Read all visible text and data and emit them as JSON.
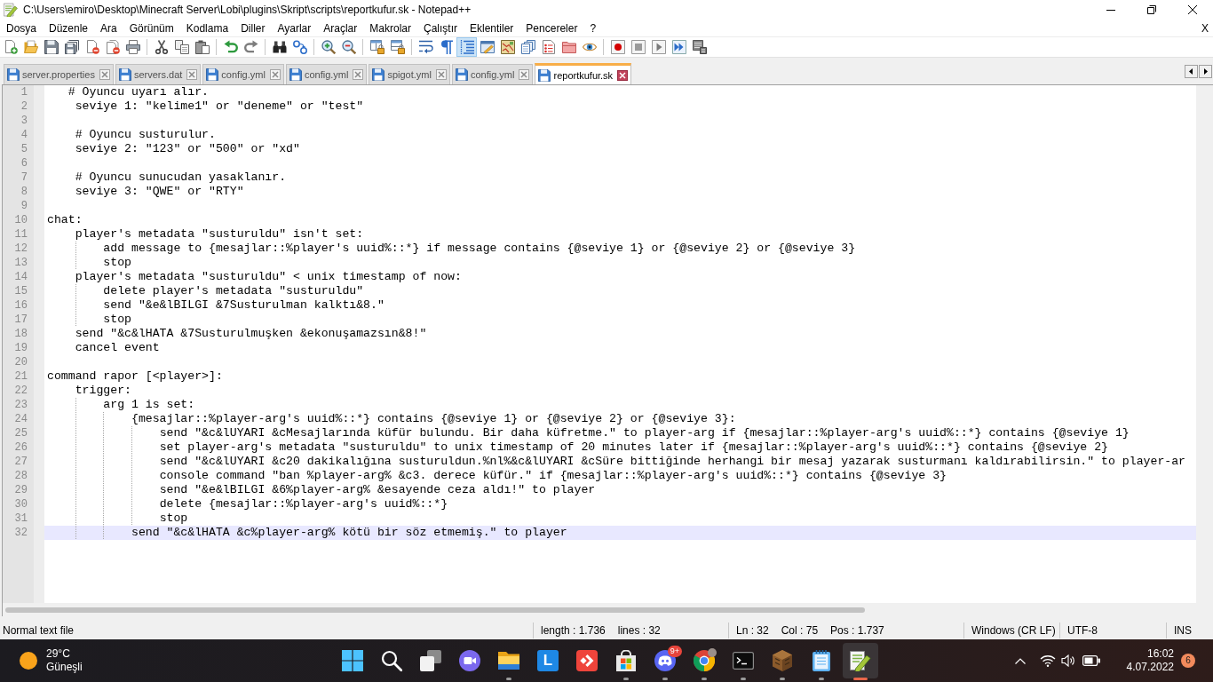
{
  "window": {
    "title": "C:\\Users\\emiro\\Desktop\\Minecraft Server\\Lobi\\plugins\\Skript\\scripts\\reportkufur.sk - Notepad++"
  },
  "menu": {
    "items": [
      "Dosya",
      "Düzenle",
      "Ara",
      "Görünüm",
      "Kodlama",
      "Diller",
      "Ayarlar",
      "Araçlar",
      "Makrolar",
      "Çalıştır",
      "Eklentiler",
      "Pencereler",
      "?"
    ],
    "close_label": "X"
  },
  "toolbar": {
    "groups": [
      [
        {
          "kind": "new",
          "selected": false
        },
        {
          "kind": "open",
          "selected": false
        },
        {
          "kind": "save",
          "selected": false
        },
        {
          "kind": "saveall",
          "selected": false
        },
        {
          "kind": "close",
          "selected": false
        },
        {
          "kind": "closeall",
          "selected": false
        },
        {
          "kind": "print",
          "selected": false
        }
      ],
      [
        {
          "kind": "cut",
          "selected": false
        },
        {
          "kind": "copy",
          "selected": false
        },
        {
          "kind": "paste",
          "selected": false
        }
      ],
      [
        {
          "kind": "undo",
          "selected": false
        },
        {
          "kind": "redo",
          "selected": false
        }
      ],
      [
        {
          "kind": "find",
          "selected": false
        },
        {
          "kind": "replace",
          "selected": false
        }
      ],
      [
        {
          "kind": "zoomin",
          "selected": false
        },
        {
          "kind": "zoomout",
          "selected": false
        }
      ],
      [
        {
          "kind": "syncv",
          "selected": false
        },
        {
          "kind": "synch",
          "selected": false
        }
      ],
      [
        {
          "kind": "wrap",
          "selected": false
        },
        {
          "kind": "pilcrow",
          "selected": false
        },
        {
          "kind": "indent",
          "selected": true
        },
        {
          "kind": "udl",
          "selected": false
        },
        {
          "kind": "docmap",
          "selected": false
        },
        {
          "kind": "doclist",
          "selected": false
        },
        {
          "kind": "funclist",
          "selected": false
        },
        {
          "kind": "workspace",
          "selected": false
        },
        {
          "kind": "monitor",
          "selected": false
        }
      ],
      [
        {
          "kind": "record",
          "selected": false
        },
        {
          "kind": "stop",
          "selected": false
        },
        {
          "kind": "play",
          "selected": false
        },
        {
          "kind": "playmulti",
          "selected": false
        },
        {
          "kind": "savemacro",
          "selected": false
        }
      ]
    ]
  },
  "tabs": [
    {
      "label": "server.properties",
      "selected": false
    },
    {
      "label": "servers.dat",
      "selected": false
    },
    {
      "label": "config.yml",
      "selected": false
    },
    {
      "label": "config.yml",
      "selected": false
    },
    {
      "label": "spigot.yml",
      "selected": false
    },
    {
      "label": "config.yml",
      "selected": false
    },
    {
      "label": "reportkufur.sk",
      "selected": true
    }
  ],
  "editor": {
    "lines": [
      {
        "number": "1",
        "text": "   # Oyuncu uyarı alır.",
        "current": false
      },
      {
        "number": "2",
        "text": "    seviye 1: \"kelime1\" or \"deneme\" or \"test\"",
        "current": false
      },
      {
        "number": "3",
        "current": false
      },
      {
        "number": "4",
        "text": "    # Oyuncu susturulur.",
        "current": false
      },
      {
        "number": "5",
        "text": "    seviye 2: \"123\" or \"500\" or \"xd\"",
        "current": false
      },
      {
        "number": "6",
        "current": false
      },
      {
        "number": "7",
        "text": "    # Oyuncu sunucudan yasaklanır.",
        "current": false
      },
      {
        "number": "8",
        "text": "    seviye 3: \"QWE\" or \"RTY\"",
        "current": false
      },
      {
        "number": "9",
        "current": false
      },
      {
        "number": "10",
        "text": "chat:",
        "current": false
      },
      {
        "number": "11",
        "text": "    player's metadata \"susturuldu\" isn't set:",
        "current": false
      },
      {
        "number": "12",
        "text": "        add message to {mesajlar::%player's uuid%::*} if message contains {@seviye 1} or {@seviye 2} or {@seviye 3}",
        "current": false
      },
      {
        "number": "13",
        "text": "        stop",
        "current": false
      },
      {
        "number": "14",
        "text": "    player's metadata \"susturuldu\" < unix timestamp of now:",
        "current": false
      },
      {
        "number": "15",
        "text": "        delete player's metadata \"susturuldu\"",
        "current": false
      },
      {
        "number": "16",
        "text": "        send \"&e&lBILGI &7Susturulman kalktı&8.\"",
        "current": false
      },
      {
        "number": "17",
        "text": "        stop",
        "current": false
      },
      {
        "number": "18",
        "text": "    send \"&c&lHATA &7Susturulmuşken &ekonuşamazsın&8!\"",
        "current": false
      },
      {
        "number": "19",
        "text": "    cancel event",
        "current": false
      },
      {
        "number": "20",
        "current": false
      },
      {
        "number": "21",
        "text": "command rapor [<player>]:",
        "current": false
      },
      {
        "number": "22",
        "text": "    trigger:",
        "current": false
      },
      {
        "number": "23",
        "text": "        arg 1 is set:",
        "current": false
      },
      {
        "number": "24",
        "text": "            {mesajlar::%player-arg's uuid%::*} contains {@seviye 1} or {@seviye 2} or {@seviye 3}:",
        "current": false
      },
      {
        "number": "25",
        "text": "                send \"&c&lUYARI &cMesajlarında küfür bulundu. Bir daha küfretme.\" to player-arg if {mesajlar::%player-arg's uuid%::*} contains {@seviye 1}",
        "current": false
      },
      {
        "number": "26",
        "text": "                set player-arg's metadata \"susturuldu\" to unix timestamp of 20 minutes later if {mesajlar::%player-arg's uuid%::*} contains {@seviye 2}",
        "current": false
      },
      {
        "number": "27",
        "text": "                send \"&c&lUYARI &c20 dakikalığına susturuldun.%nl%&c&lUYARI &cSüre bittiğinde herhangi bir mesaj yazarak susturmanı kaldırabilirsin.\" to player-ar",
        "current": false
      },
      {
        "number": "28",
        "text": "                console command \"ban %player-arg% &c3. derece küfür.\" if {mesajlar::%player-arg's uuid%::*} contains {@seviye 3}",
        "current": false
      },
      {
        "number": "29",
        "text": "                send \"&e&lBILGI &6%player-arg% &esayende ceza aldı!\" to player",
        "current": false
      },
      {
        "number": "30",
        "text": "                delete {mesajlar::%player-arg's uuid%::*}",
        "current": false
      },
      {
        "number": "31",
        "text": "                stop",
        "current": false
      },
      {
        "number": "32",
        "text": "            send \"&c&lHATA &c%player-arg% kötü bir söz etmemiş.\" to player",
        "current": true
      }
    ]
  },
  "status_bar": {
    "file_type": "Normal text file",
    "length": "length : 1.736",
    "lines": "lines : 32",
    "line": "Ln : 32",
    "column": "Col : 75",
    "position": "Pos : 1.737",
    "eol": "Windows (CR LF)",
    "encoding": "UTF-8",
    "mode": "INS"
  },
  "taskbar": {
    "weather": {
      "temperature": "29°C",
      "condition": "Güneşli"
    },
    "apps": [
      {
        "kind": "start",
        "running": false,
        "selected": false
      },
      {
        "kind": "search",
        "running": false,
        "selected": false
      },
      {
        "kind": "taskview",
        "running": false,
        "selected": false
      },
      {
        "kind": "chat",
        "running": false,
        "selected": false
      },
      {
        "kind": "explorer",
        "running": true,
        "selected": false
      },
      {
        "kind": "letter",
        "glyph": "L",
        "running": false,
        "selected": false
      },
      {
        "kind": "remote",
        "running": false,
        "selected": false
      },
      {
        "kind": "store",
        "running": true,
        "selected": false
      },
      {
        "kind": "messenger",
        "badge": "9+",
        "running": true,
        "selected": false
      },
      {
        "kind": "browser",
        "running": true,
        "selected": false
      },
      {
        "kind": "terminal",
        "running": true,
        "selected": false
      },
      {
        "kind": "game",
        "running": true,
        "selected": false
      },
      {
        "kind": "notepad",
        "running": true,
        "selected": false
      },
      {
        "kind": "editor",
        "running": true,
        "selected": true
      }
    ],
    "clock": {
      "time": "16:02",
      "date": "4.07.2022"
    },
    "notifications": "6"
  }
}
